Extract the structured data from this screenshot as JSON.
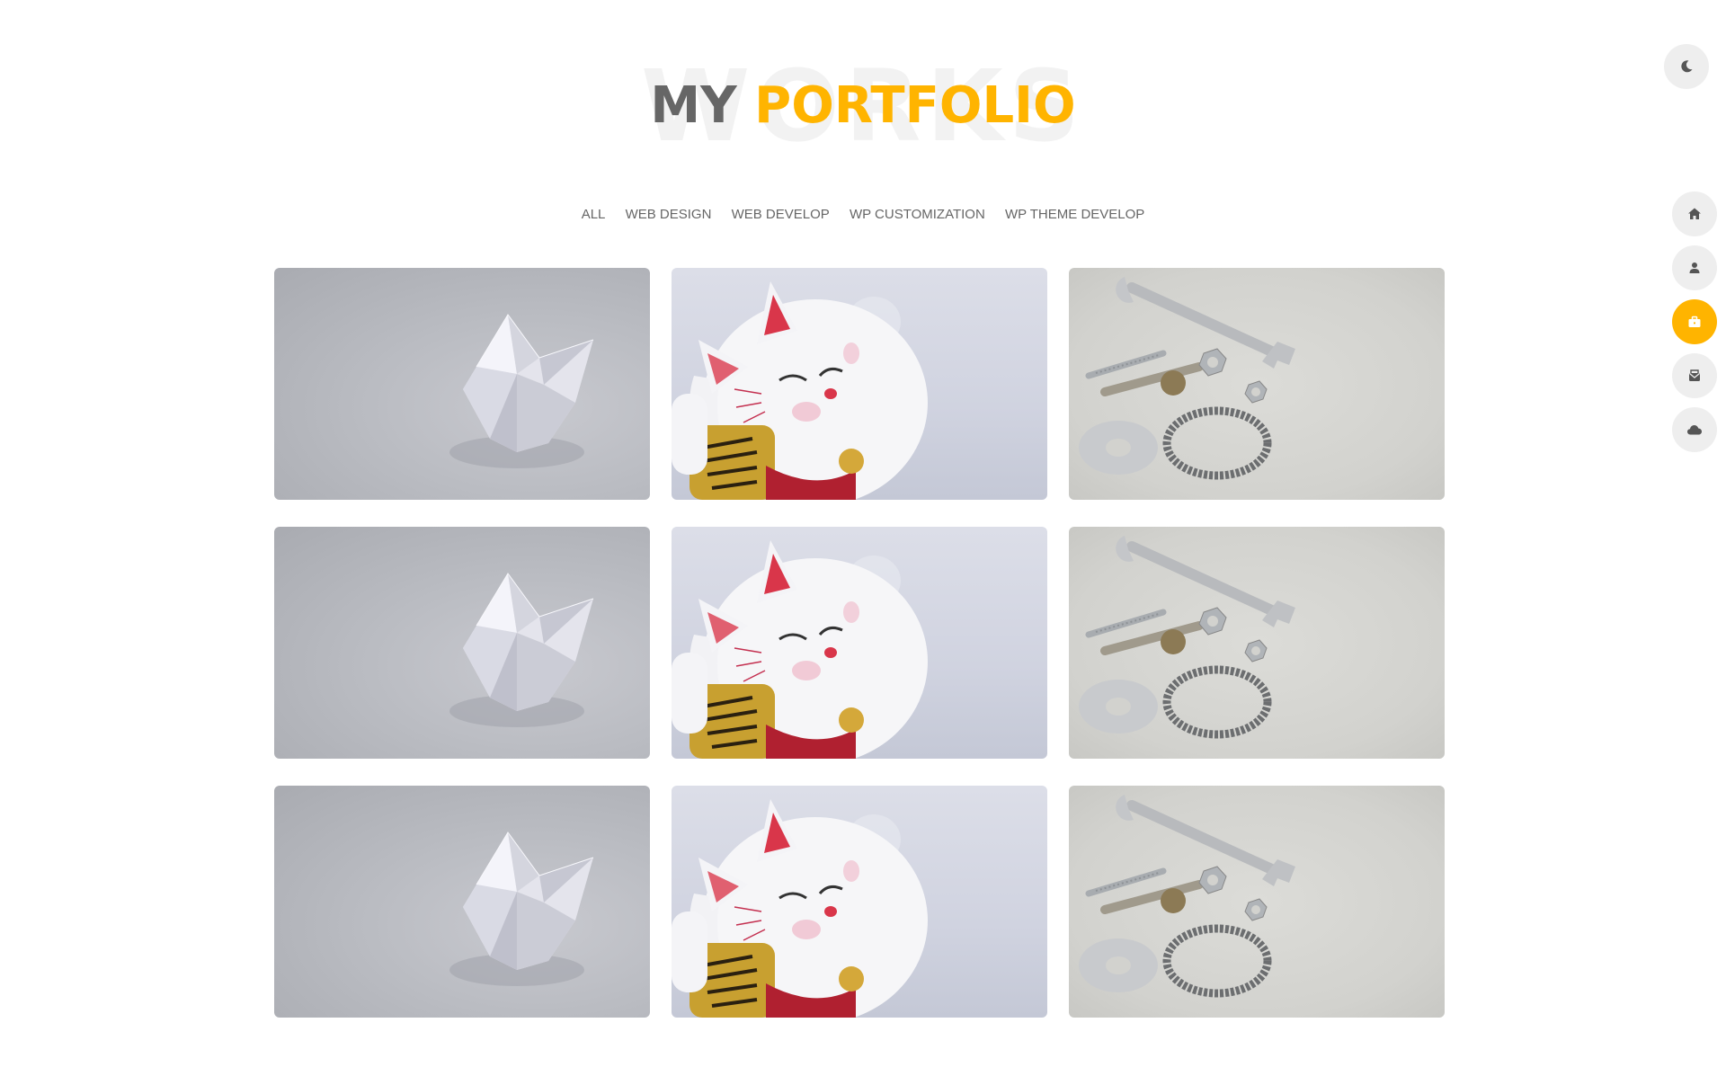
{
  "heading": {
    "background_word": "WORKS",
    "title_part1": "MY",
    "title_part2": "PORTFOLIO"
  },
  "filters": [
    {
      "label": "ALL"
    },
    {
      "label": "WEB DESIGN"
    },
    {
      "label": "WEB DEVELOP"
    },
    {
      "label": "WP CUSTOMIZATION"
    },
    {
      "label": "WP THEME DEVELOP"
    }
  ],
  "portfolio_items": [
    {
      "image": "origami"
    },
    {
      "image": "lucky-cat"
    },
    {
      "image": "tools"
    },
    {
      "image": "origami"
    },
    {
      "image": "lucky-cat"
    },
    {
      "image": "tools"
    },
    {
      "image": "origami"
    },
    {
      "image": "lucky-cat"
    },
    {
      "image": "tools"
    }
  ],
  "theme_toggle": {
    "icon": "moon-icon"
  },
  "side_nav": [
    {
      "icon": "home-icon",
      "active": false
    },
    {
      "icon": "user-icon",
      "active": false
    },
    {
      "icon": "briefcase-icon",
      "active": true
    },
    {
      "icon": "mail-icon",
      "active": false
    },
    {
      "icon": "cloud-icon",
      "active": false
    }
  ],
  "colors": {
    "accent": "#ffb400",
    "heading_dark": "#666666",
    "nav_bg": "#eeeeee",
    "text": "#666666"
  }
}
